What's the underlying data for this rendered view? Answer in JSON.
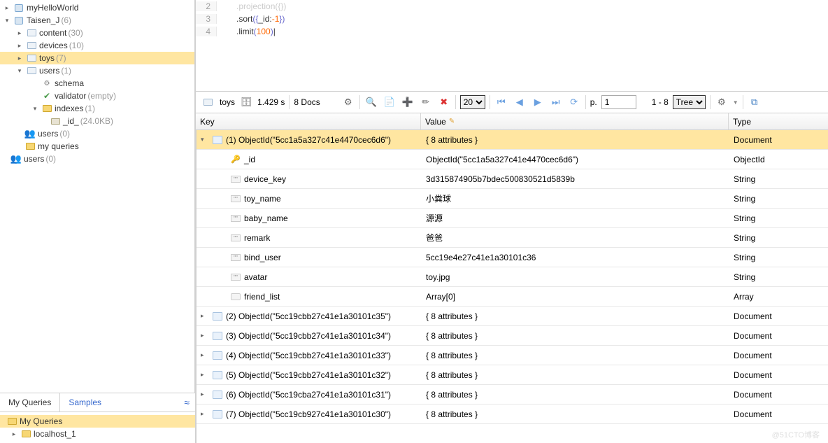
{
  "tree": {
    "db1": "myHelloWorld",
    "db2": "Taisen_J",
    "db2_count": "(6)",
    "colls": [
      {
        "name": "content",
        "count": "(30)",
        "sel": false
      },
      {
        "name": "devices",
        "count": "(10)",
        "sel": false
      },
      {
        "name": "toys",
        "count": "(7)",
        "sel": true
      },
      {
        "name": "users",
        "count": "(1)",
        "sel": false
      }
    ],
    "schema": "schema",
    "validator": "validator",
    "validator_note": "(empty)",
    "indexes": "indexes",
    "indexes_count": "(1)",
    "indexes_id": "_id_",
    "indexes_id_size": "(24.0KB)",
    "users0a": "users",
    "users0a_count": "(0)",
    "myqueries": "my queries",
    "users0b": "users",
    "users0b_count": "(0)"
  },
  "tabs": {
    "q": "My Queries",
    "s": "Samples"
  },
  "qtree": {
    "root": "My Queries",
    "host": "localhost_1"
  },
  "code": {
    "l2": ".projection({})",
    "l3_a": ".sort",
    "l3_b": "_id:",
    "l3_c": "-1",
    "l4_a": ".limit",
    "l4_b": "100"
  },
  "toolbar": {
    "coll": "toys",
    "time": "1.429 s",
    "docs": "8 Docs",
    "page_size": "20",
    "page_no": "1",
    "range": "1 - 8",
    "view": "Tree",
    "p": "p."
  },
  "columns": {
    "key": "Key",
    "val": "Value",
    "type": "Type"
  },
  "rows": [
    {
      "depth": 0,
      "arrow": "▾",
      "icon": "doc",
      "key": "(1) ObjectId(\"5cc1a5a327c41e4470cec6d6\")",
      "val": "{ 8 attributes }",
      "type": "Document",
      "sel": true
    },
    {
      "depth": 1,
      "arrow": "",
      "icon": "key",
      "key": "_id",
      "val": "ObjectId(\"5cc1a5a327c41e4470cec6d6\")",
      "type": "ObjectId"
    },
    {
      "depth": 1,
      "arrow": "",
      "icon": "str",
      "key": "device_key",
      "val": "3d315874905b7bdec500830521d5839b",
      "type": "String"
    },
    {
      "depth": 1,
      "arrow": "",
      "icon": "str",
      "key": "toy_name",
      "val": "小粪球",
      "type": "String"
    },
    {
      "depth": 1,
      "arrow": "",
      "icon": "str",
      "key": "baby_name",
      "val": "源源",
      "type": "String"
    },
    {
      "depth": 1,
      "arrow": "",
      "icon": "str",
      "key": "remark",
      "val": "爸爸",
      "type": "String"
    },
    {
      "depth": 1,
      "arrow": "",
      "icon": "str",
      "key": "bind_user",
      "val": "5cc19e4e27c41e1a30101c36",
      "type": "String"
    },
    {
      "depth": 1,
      "arrow": "",
      "icon": "str",
      "key": "avatar",
      "val": "toy.jpg",
      "type": "String"
    },
    {
      "depth": 1,
      "arrow": "",
      "icon": "arr",
      "key": "friend_list",
      "val": "Array[0]",
      "type": "Array"
    },
    {
      "depth": 0,
      "arrow": "▸",
      "icon": "doc",
      "key": "(2) ObjectId(\"5cc19cbb27c41e1a30101c35\")",
      "val": "{ 8 attributes }",
      "type": "Document"
    },
    {
      "depth": 0,
      "arrow": "▸",
      "icon": "doc",
      "key": "(3) ObjectId(\"5cc19cbb27c41e1a30101c34\")",
      "val": "{ 8 attributes }",
      "type": "Document"
    },
    {
      "depth": 0,
      "arrow": "▸",
      "icon": "doc",
      "key": "(4) ObjectId(\"5cc19cbb27c41e1a30101c33\")",
      "val": "{ 8 attributes }",
      "type": "Document"
    },
    {
      "depth": 0,
      "arrow": "▸",
      "icon": "doc",
      "key": "(5) ObjectId(\"5cc19cbb27c41e1a30101c32\")",
      "val": "{ 8 attributes }",
      "type": "Document"
    },
    {
      "depth": 0,
      "arrow": "▸",
      "icon": "doc",
      "key": "(6) ObjectId(\"5cc19cba27c41e1a30101c31\")",
      "val": "{ 8 attributes }",
      "type": "Document"
    },
    {
      "depth": 0,
      "arrow": "▸",
      "icon": "doc",
      "key": "(7) ObjectId(\"5cc19cb927c41e1a30101c30\")",
      "val": "{ 8 attributes }",
      "type": "Document"
    }
  ],
  "watermark": "@51CTO博客"
}
